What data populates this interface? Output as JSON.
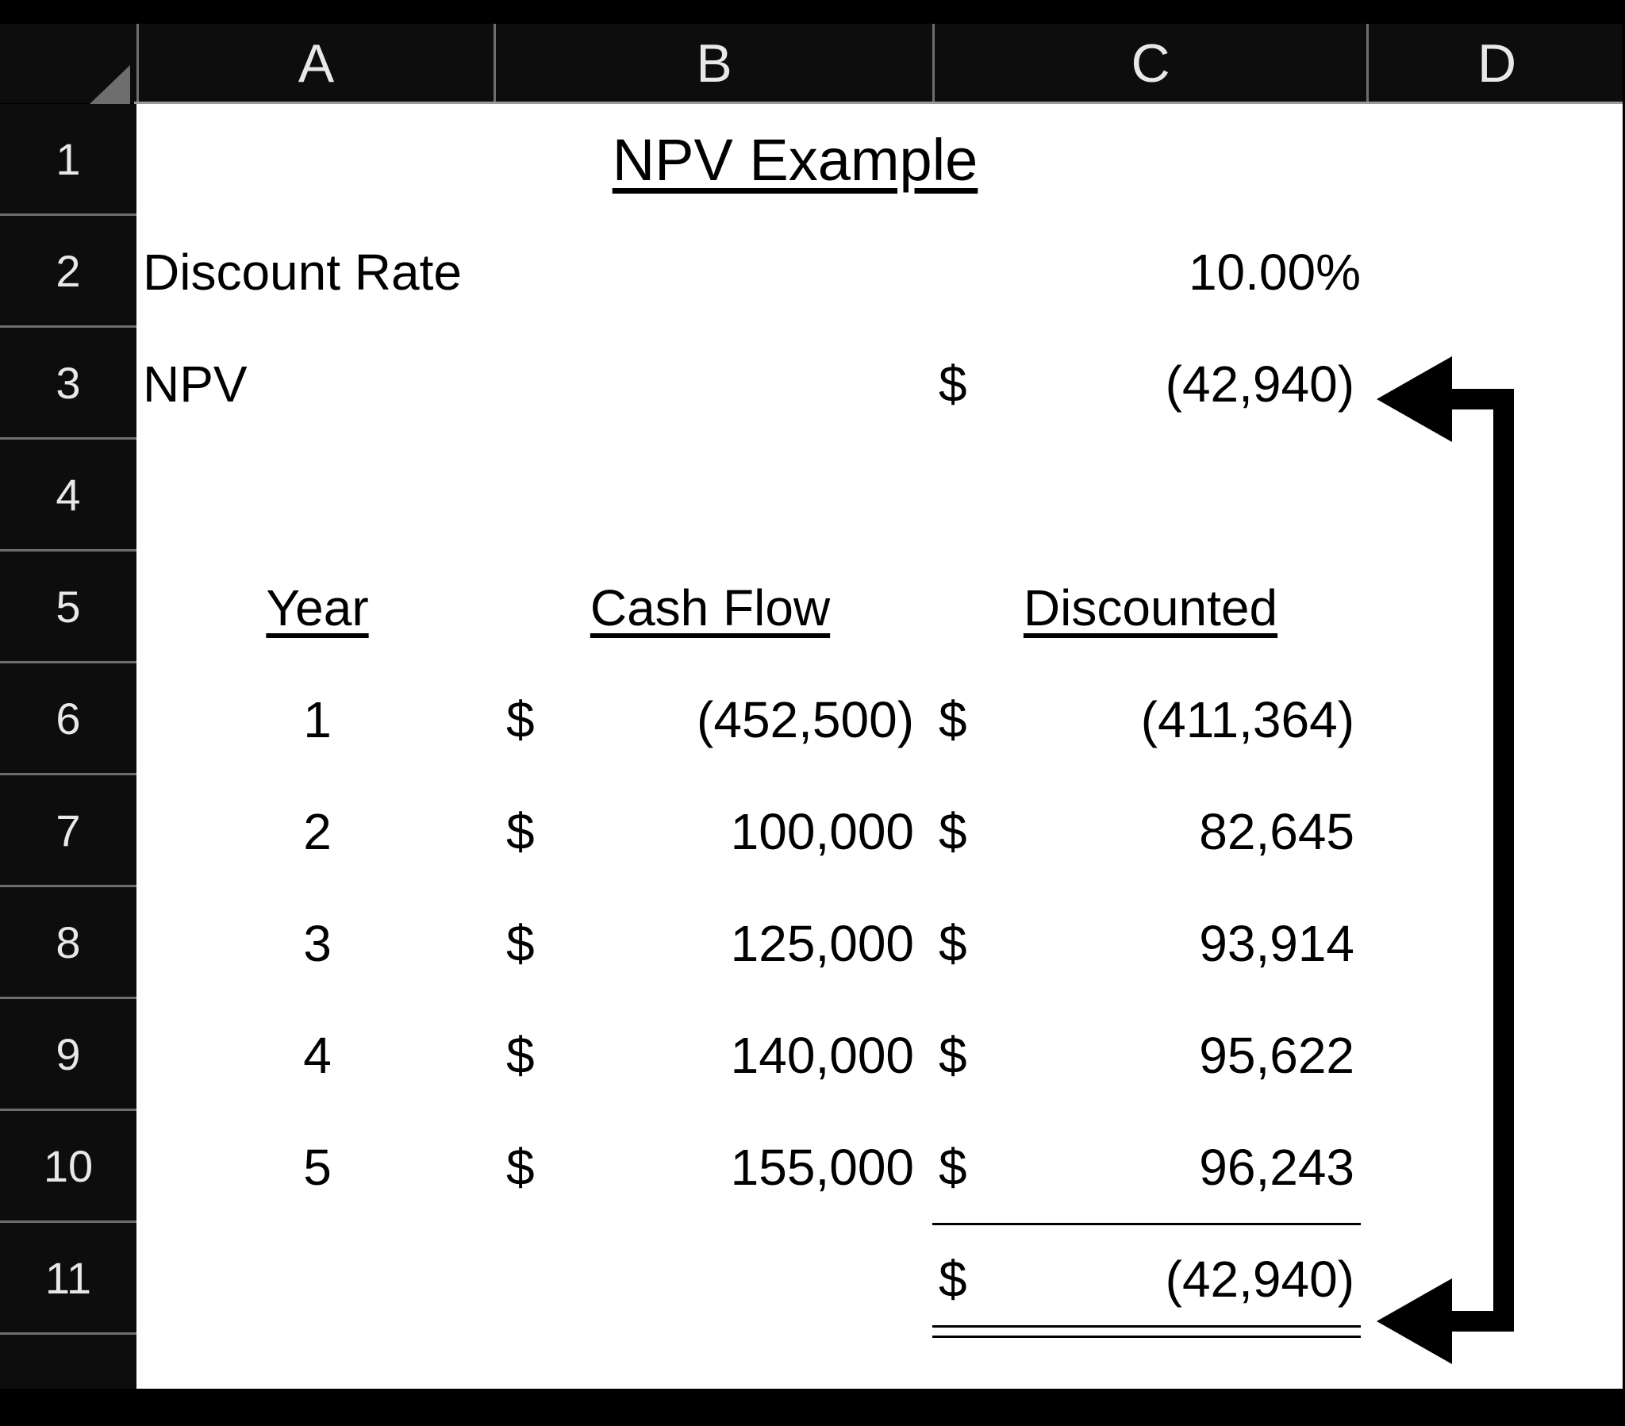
{
  "app": {
    "kind": "spreadsheet",
    "select_all_icon": "select-all-triangle-icon"
  },
  "colors": {
    "header_background": "#0d0d0d",
    "header_text": "#e8e8e8",
    "gridline": "#9a9a9a",
    "sheet_background": "#ffffff",
    "cell_text": "#000000",
    "annotation": "#000000",
    "corner_triangle": "#6e6e6e"
  },
  "columns": [
    {
      "label": "A"
    },
    {
      "label": "B"
    },
    {
      "label": "C"
    },
    {
      "label": "D"
    }
  ],
  "rows": [
    {
      "label": "1"
    },
    {
      "label": "2"
    },
    {
      "label": "3"
    },
    {
      "label": "4"
    },
    {
      "label": "5"
    },
    {
      "label": "6"
    },
    {
      "label": "7"
    },
    {
      "label": "8"
    },
    {
      "label": "9"
    },
    {
      "label": "10"
    },
    {
      "label": "11"
    }
  ],
  "cells": {
    "title": "NPV Example",
    "discount_rate_label": "Discount Rate",
    "discount_rate_value": "10.00%",
    "npv_label": "NPV",
    "npv_currency": "$",
    "npv_value": "(42,940)",
    "header_year": "Year",
    "header_cash_flow": "Cash Flow",
    "header_discounted": "Discounted",
    "total_currency": "$",
    "total_value": "(42,940)"
  },
  "chart_data": {
    "type": "table",
    "title": "NPV Example",
    "columns": [
      "Year",
      "Cash Flow",
      "Discounted"
    ],
    "discount_rate": 0.1,
    "npv": -42940,
    "rows": [
      {
        "year": "1",
        "cash_flow_currency": "$",
        "cash_flow": "(452,500)",
        "discounted_currency": "$",
        "discounted": "(411,364)"
      },
      {
        "year": "2",
        "cash_flow_currency": "$",
        "cash_flow": "100,000",
        "discounted_currency": "$",
        "discounted": "82,645"
      },
      {
        "year": "3",
        "cash_flow_currency": "$",
        "cash_flow": "125,000",
        "discounted_currency": "$",
        "discounted": "93,914"
      },
      {
        "year": "4",
        "cash_flow_currency": "$",
        "cash_flow": "140,000",
        "discounted_currency": "$",
        "discounted": "95,622"
      },
      {
        "year": "5",
        "cash_flow_currency": "$",
        "cash_flow": "155,000",
        "discounted_currency": "$",
        "discounted": "96,243"
      }
    ],
    "total": {
      "currency": "$",
      "value": "(42,940)"
    }
  },
  "annotations": [
    {
      "name": "arrow-to-npv-cell",
      "points_to": "NPV"
    },
    {
      "name": "arrow-to-total-cell",
      "points_to": "Total"
    }
  ]
}
